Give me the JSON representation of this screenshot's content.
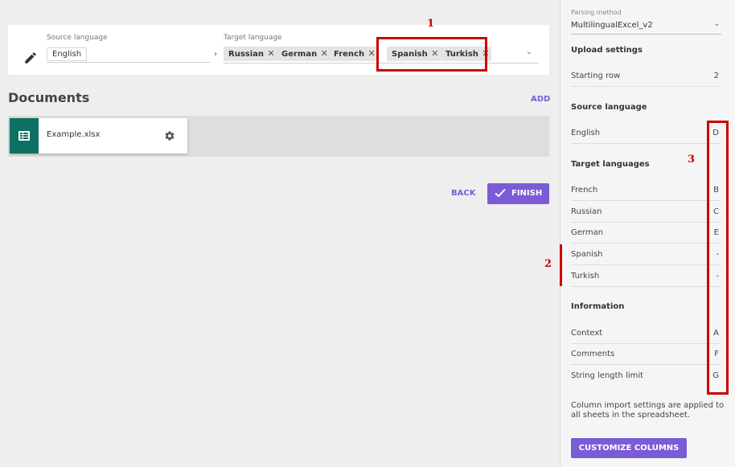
{
  "language_bar": {
    "source_label": "Source language",
    "source_value": "English",
    "arrow": "›",
    "target_label": "Target language",
    "target_chips": [
      {
        "label": "Russian",
        "remove": "✕"
      },
      {
        "label": "German",
        "remove": "✕"
      },
      {
        "label": "French",
        "remove": "✕"
      },
      {
        "label": "Spanish",
        "remove": "✕"
      },
      {
        "label": "Turkish",
        "remove": "✕"
      }
    ],
    "dropdown_icon": "⌄"
  },
  "annotations": {
    "n1": "1",
    "n2": "2",
    "n3": "3",
    "color": "#cc0000"
  },
  "documents": {
    "title": "Documents",
    "add_label": "ADD",
    "files": [
      {
        "name": "Example.xlsx",
        "icon": "spreadsheet-icon"
      }
    ]
  },
  "actions": {
    "back_label": "BACK",
    "finish_label": "FINISH"
  },
  "sidebar": {
    "parsing_method_label": "Parsing method",
    "parsing_method_value": "MultilingualExcel_v2",
    "upload_settings_title": "Upload settings",
    "starting_row_label": "Starting row",
    "starting_row_value": "2",
    "source_language_title": "Source language",
    "source_rows": [
      {
        "label": "English",
        "value": "D"
      }
    ],
    "target_languages_title": "Target languages",
    "target_rows": [
      {
        "label": "French",
        "value": "B"
      },
      {
        "label": "Russian",
        "value": "C"
      },
      {
        "label": "German",
        "value": "E"
      },
      {
        "label": "Spanish",
        "value": "-"
      },
      {
        "label": "Turkish",
        "value": "-"
      }
    ],
    "information_title": "Information",
    "info_rows": [
      {
        "label": "Context",
        "value": "A"
      },
      {
        "label": "Comments",
        "value": "F"
      },
      {
        "label": "String length limit",
        "value": "G"
      }
    ],
    "note": "Column import settings are applied to all sheets in the spreadsheet.",
    "customize_label": "CUSTOMIZE COLUMNS"
  },
  "colors": {
    "accent": "#7b5cd6",
    "doc_icon_bg": "#0e7060",
    "annotation": "#cc0000"
  }
}
